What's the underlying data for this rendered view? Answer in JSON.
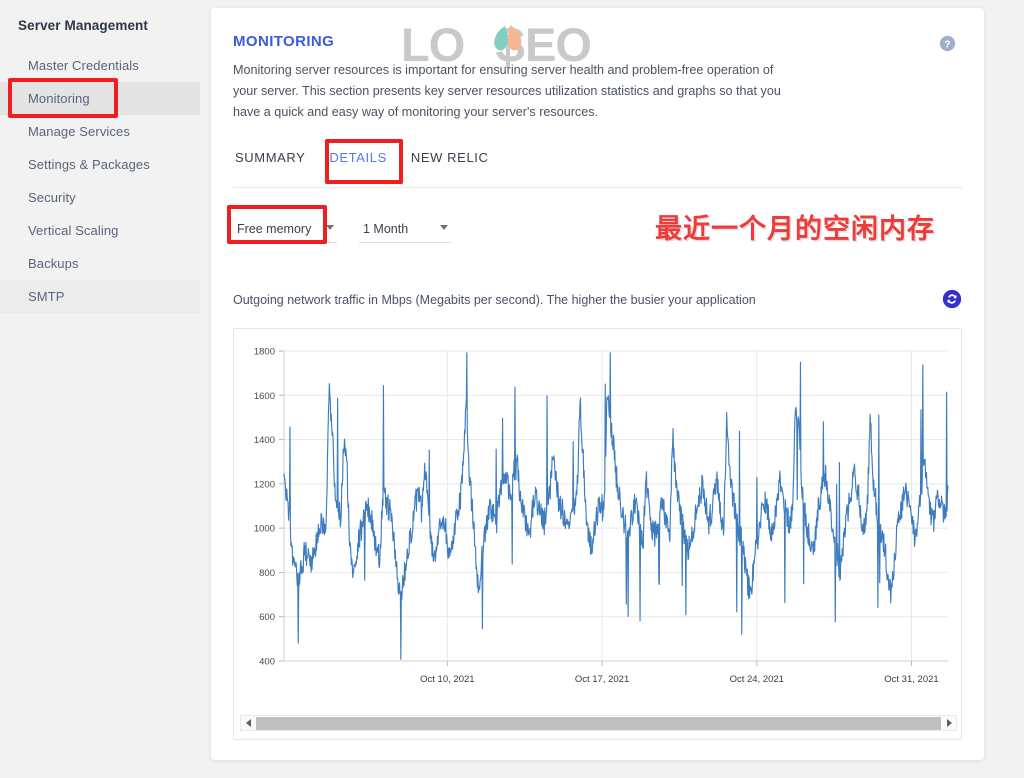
{
  "sidebar": {
    "title": "Server Management",
    "items": [
      {
        "label": "Master Credentials",
        "state": "normal"
      },
      {
        "label": "Monitoring",
        "state": "active"
      },
      {
        "label": "Manage Services",
        "state": "normal"
      },
      {
        "label": "Settings & Packages",
        "state": "normal"
      },
      {
        "label": "Security",
        "state": "normal"
      },
      {
        "label": "Vertical Scaling",
        "state": "normal"
      },
      {
        "label": "Backups",
        "state": "normal"
      },
      {
        "label": "SMTP",
        "state": "soft"
      }
    ]
  },
  "header": {
    "title": "MONITORING",
    "description": "Monitoring server resources is important for ensuring server health and problem-free operation of your server. This section presents key server resources utilization statistics and graphs so that you have a quick and easy way of monitoring your server's resources.",
    "help_icon": "question-circle-icon",
    "watermark": "LO SEO",
    "watermark_part1": "LO",
    "watermark_part2": "SEO"
  },
  "tabs": [
    {
      "label": "SUMMARY",
      "active": false
    },
    {
      "label": "DETAILS",
      "active": true
    },
    {
      "label": "NEW RELIC",
      "active": false
    }
  ],
  "selectors": {
    "metric": {
      "value": "Free memory",
      "icon": "chevron-down-icon"
    },
    "period": {
      "value": "1 Month",
      "icon": "chevron-down-icon"
    }
  },
  "annotation": {
    "text": "最近一个月的空闲内存",
    "color": "#f03b3b",
    "boxes": [
      "monitoring-sidebar-item",
      "details-tab",
      "free-memory-select"
    ]
  },
  "chart_caption": "Outgoing network traffic in Mbps (Megabits per second). The higher the busier your application",
  "refresh_icon": "refresh-icon",
  "scrollbar": {
    "left_arrow": "triangle-left-icon",
    "right_arrow": "triangle-right-icon"
  },
  "colors": {
    "accent_blue": "#3b5bdb",
    "tab_active": "#5779e9",
    "line": "#3d7cbf",
    "annotation_red": "#f01f1f",
    "sidebar_active_bg": "#e4e4e4"
  },
  "chart_data": {
    "type": "line",
    "title": "",
    "xlabel": "",
    "ylabel": "",
    "ylim": [
      400,
      1800
    ],
    "yticks": [
      400,
      600,
      800,
      1000,
      1200,
      1400,
      1600,
      1800
    ],
    "xticks": [
      "Oct 10, 2021",
      "Oct 17, 2021",
      "Oct 24, 2021",
      "Oct 31, 2021"
    ],
    "xtick_positions": [
      0.246,
      0.479,
      0.712,
      0.945
    ],
    "grid": true,
    "legend": "none",
    "series": [
      {
        "name": "Free memory",
        "color": "#3d7cbf",
        "values": [
          1198,
          1150,
          1020,
          860,
          790,
          755,
          820,
          905,
          870,
          845,
          880,
          930,
          1025,
          1000,
          960,
          1630,
          1480,
          1200,
          1100,
          1040,
          1390,
          1300,
          900,
          815,
          880,
          940,
          1010,
          1060,
          1100,
          1055,
          980,
          900,
          860,
          1150,
          1125,
          1090,
          1050,
          900,
          745,
          700,
          760,
          880,
          950,
          1000,
          1120,
          1140,
          1080,
          1240,
          1200,
          960,
          880,
          920,
          990,
          1060,
          1010,
          875,
          900,
          1000,
          1080,
          1145,
          1320,
          1550,
          1240,
          1080,
          900,
          700,
          850,
          960,
          1040,
          1100,
          1070,
          1010,
          1150,
          1200,
          1250,
          1180,
          1140,
          1260,
          1275,
          1150,
          1060,
          1005,
          950,
          1090,
          1140,
          1100,
          1060,
          1010,
          1140,
          1180,
          1350,
          1230,
          1100,
          1080,
          1020,
          980,
          1040,
          1100,
          1160,
          1580,
          1320,
          1060,
          960,
          900,
          1000,
          1080,
          1120,
          1055,
          1600,
          1480,
          1400,
          1250,
          1160,
          1090,
          1010,
          940,
          1030,
          1110,
          1080,
          1000,
          920,
          1240,
          1100,
          1000,
          960,
          1030,
          1120,
          1085,
          1045,
          980,
          1430,
          1200,
          1100,
          1040,
          960,
          890,
          930,
          1010,
          1090,
          1140,
          1200,
          1100,
          1030,
          1080,
          1150,
          1210,
          1060,
          980,
          1500,
          1230,
          1140,
          1080,
          1000,
          940,
          870,
          755,
          690,
          820,
          930,
          1010,
          1070,
          1120,
          1060,
          980,
          1040,
          1160,
          1220,
          1130,
          1060,
          1020,
          1090,
          1550,
          1480,
          1220,
          1090,
          1000,
          940,
          890,
          1010,
          1120,
          1180,
          1240,
          1130,
          1040,
          960,
          880,
          800,
          920,
          1040,
          1120,
          1190,
          1250,
          1150,
          1060,
          1000,
          1080,
          1490,
          1230,
          1100,
          1020,
          960,
          890,
          780,
          700,
          860,
          980,
          1070,
          1130,
          1180,
          1090,
          1010,
          960,
          1050,
          1130,
          1340,
          1180,
          1080,
          1020,
          1090,
          1150,
          1100,
          1050,
          1170
        ]
      }
    ]
  }
}
